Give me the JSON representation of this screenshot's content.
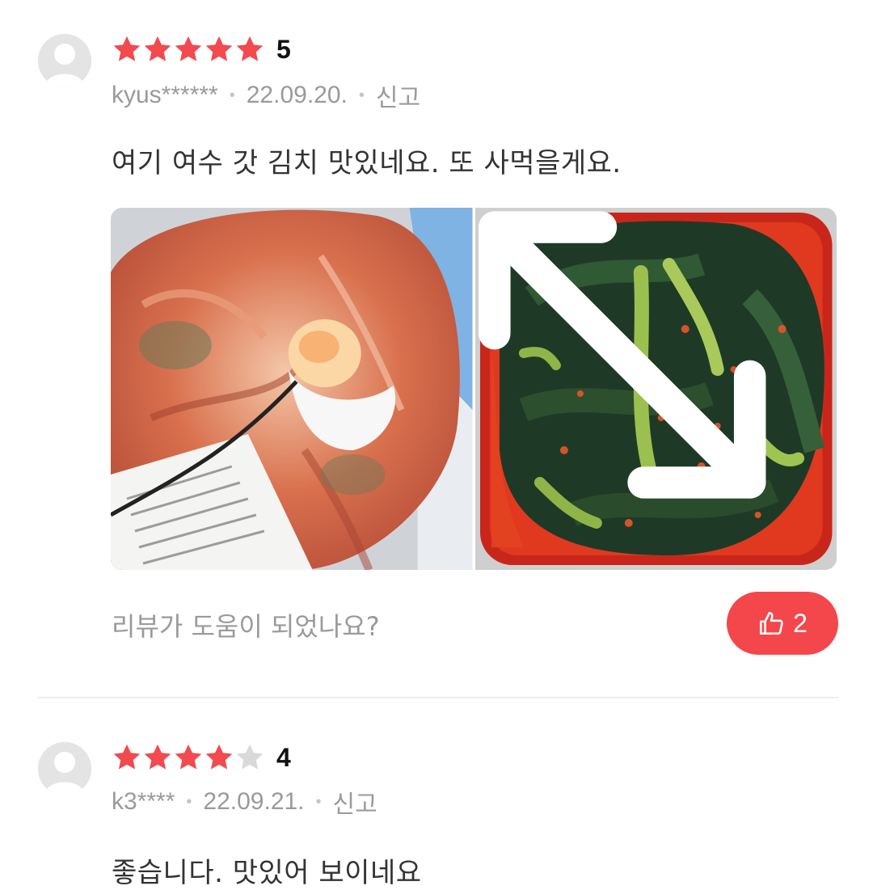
{
  "reviews": [
    {
      "rating": 5,
      "rating_label": "5",
      "username": "kyus******",
      "date": "22.09.20.",
      "report_label": "신고",
      "text": "여기 여수 갓 김치 맛있네요. 또 사먹을게요.",
      "photos": [
        "kimchi-bag-photo",
        "mustard-green-kimchi-photo"
      ],
      "helpful_question": "리뷰가 도움이 되었나요?",
      "like_count": "2"
    },
    {
      "rating": 4,
      "rating_label": "4",
      "username": "k3****",
      "date": "22.09.21.",
      "report_label": "신고",
      "text": "좋습니다. 맛있어 보이네요"
    }
  ],
  "colors": {
    "star_filled": "#f24a4f",
    "star_empty": "#d9d9d9",
    "like_button": "#f4474c",
    "meta_text": "#9a9a9a"
  },
  "icons": {
    "avatar": "user-silhouette-icon",
    "star": "star-icon",
    "expand": "expand-arrows-icon",
    "like": "thumbs-up-icon"
  }
}
